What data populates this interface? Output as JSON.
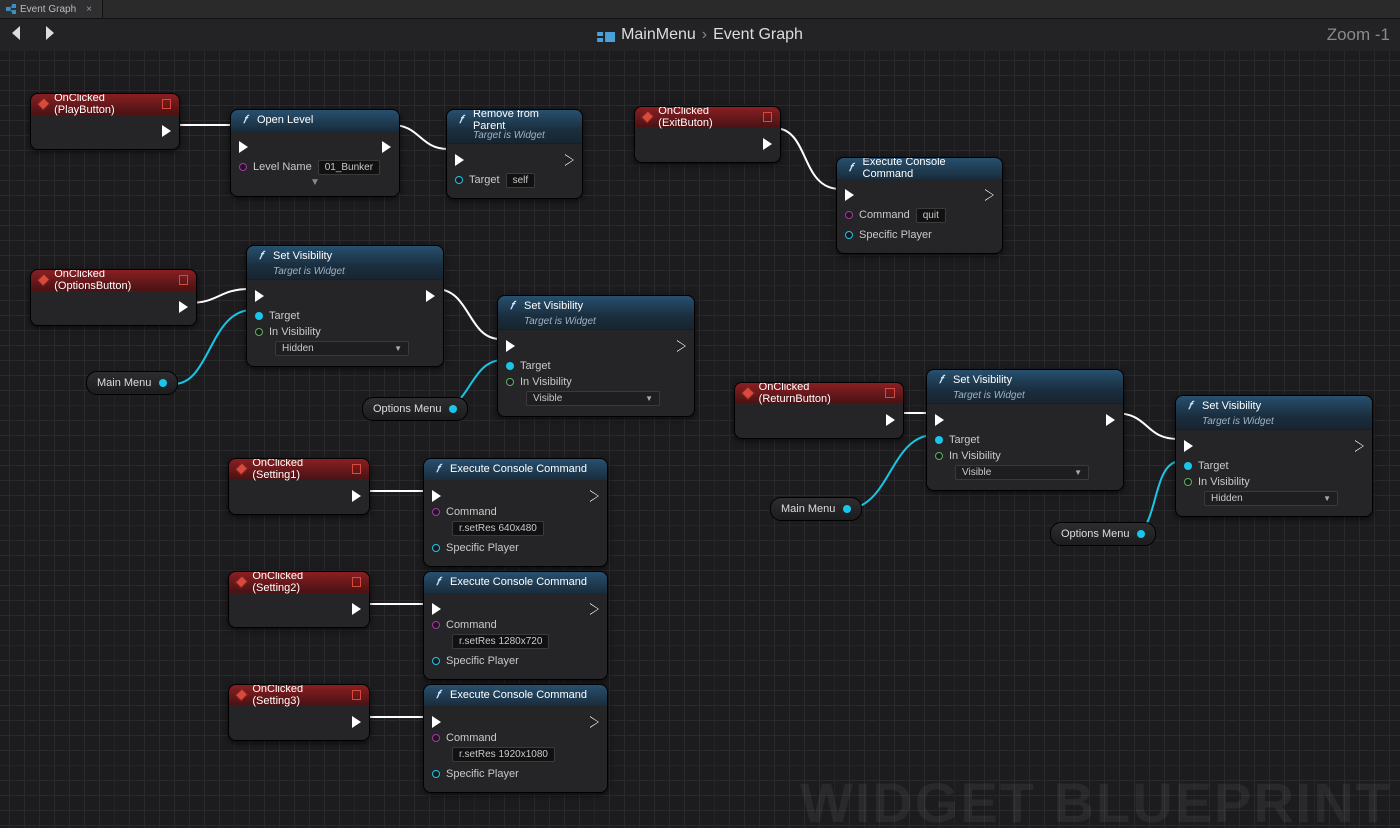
{
  "tab": {
    "title": "Event Graph",
    "close": "×"
  },
  "nav": {
    "back": "‹",
    "fwd": "›"
  },
  "breadcrumb": {
    "root": "MainMenu",
    "sep": "›",
    "leaf": "Event Graph"
  },
  "zoom": "Zoom -1",
  "watermark": "WIDGET BLUEPRINT",
  "events": {
    "play": "OnClicked (PlayButton)",
    "options": "OnClicked (OptionsButton)",
    "setting1": "OnClicked (Setting1)",
    "setting2": "OnClicked (Setting2)",
    "setting3": "OnClicked (Setting3)",
    "exit": "OnClicked (ExitButon)",
    "return": "OnClicked (ReturnButton)"
  },
  "labels": {
    "openLevel": "Open Level",
    "levelName": "Level Name",
    "levelVal": "01_Bunker",
    "removeParent": "Remove from Parent",
    "targetIsWidget": "Target is Widget",
    "target": "Target",
    "self": "self",
    "setVis": "Set Visibility",
    "inVis": "In Visibility",
    "hidden": "Hidden",
    "visible": "Visible",
    "execCmd": "Execute Console Command",
    "command": "Command",
    "specPlayer": "Specific Player",
    "quit": "quit",
    "res1": "r.setRes 640x480",
    "res2": "r.setRes 1280x720",
    "res3": "r.setRes 1920x1080"
  },
  "vars": {
    "mainMenu": "Main Menu",
    "optionsMenu": "Options Menu"
  }
}
